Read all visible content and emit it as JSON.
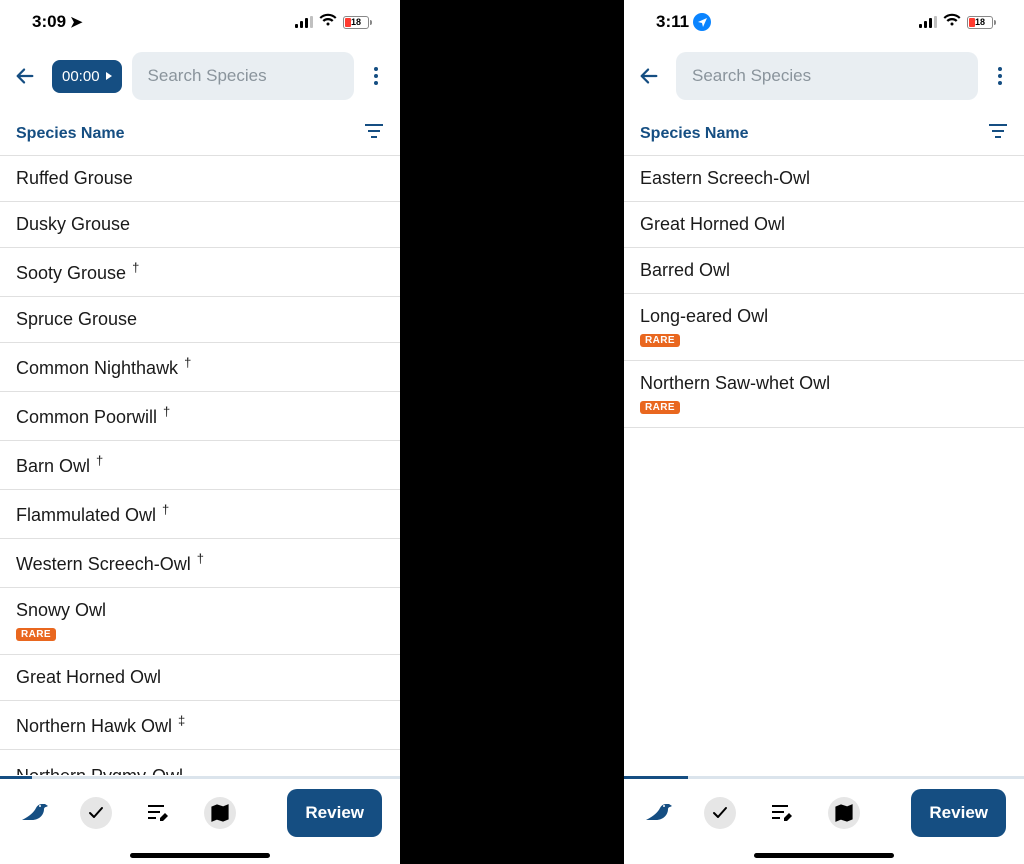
{
  "left": {
    "status": {
      "time": "3:09",
      "battery": "18",
      "location_style": "arrow"
    },
    "toolbar": {
      "show_timer": true,
      "timer_label": "00:00",
      "search_placeholder": "Search Species"
    },
    "sort_header": "Species Name",
    "species": [
      {
        "name": "Ruffed Grouse"
      },
      {
        "name": "Dusky Grouse"
      },
      {
        "name": "Sooty Grouse",
        "mark": "†"
      },
      {
        "name": "Spruce Grouse"
      },
      {
        "name": "Common Nighthawk",
        "mark": "†"
      },
      {
        "name": "Common Poorwill",
        "mark": "†"
      },
      {
        "name": "Barn Owl",
        "mark": "†"
      },
      {
        "name": "Flammulated Owl",
        "mark": "†"
      },
      {
        "name": "Western Screech-Owl",
        "mark": "†"
      },
      {
        "name": "Snowy Owl",
        "rare": true
      },
      {
        "name": "Great Horned Owl"
      },
      {
        "name": "Northern Hawk Owl",
        "mark": "‡"
      },
      {
        "name": "Northern Pygmy-Owl",
        "cut": true
      }
    ],
    "rare_label": "RARE",
    "review_label": "Review",
    "progress": 8
  },
  "right": {
    "status": {
      "time": "3:11",
      "battery": "18",
      "location_style": "badge"
    },
    "toolbar": {
      "show_timer": false,
      "search_placeholder": "Search Species"
    },
    "sort_header": "Species Name",
    "species": [
      {
        "name": "Eastern Screech-Owl"
      },
      {
        "name": "Great Horned Owl"
      },
      {
        "name": "Barred Owl"
      },
      {
        "name": "Long-eared Owl",
        "rare": true
      },
      {
        "name": "Northern Saw-whet Owl",
        "rare": true
      }
    ],
    "rare_label": "RARE",
    "review_label": "Review",
    "progress": 16
  }
}
